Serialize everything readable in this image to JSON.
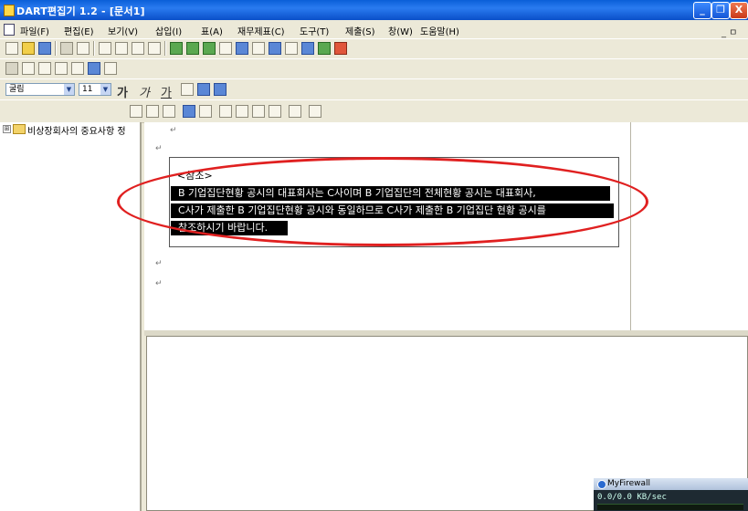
{
  "window": {
    "title": "DART편집기 1.2 - [문서1]",
    "controls": {
      "minimize": "_",
      "restore": "❐",
      "close": "X"
    }
  },
  "menubar": {
    "items": [
      "파일(F)",
      "편집(E)",
      "보기(V)",
      "삽입(I)",
      "표(A)",
      "재무제표(C)",
      "도구(T)",
      "제출(S)",
      "창(W)",
      "도움말(H)"
    ],
    "mdi_controls": "_ ㅁ"
  },
  "format_toolbar": {
    "font": "굴림",
    "size": "11",
    "bold": "가",
    "italic": "가",
    "underline": "가"
  },
  "tree": {
    "expander": "⊞",
    "root_label": "비상장회사의 중요사항 정"
  },
  "editor": {
    "para_mark": "↵",
    "ref_title": "<참조>",
    "highlight_lines": [
      "B 기업집단현황 공시의 대표회사는 C사이며 B 기업집단의 전체현황 공시는 대표회사,",
      "C사가 제출한 B 기업집단현황 공시와 동일하므로 C사가 제출한 B 기업집단 현황 공시를",
      "참조하시기 바랍니다."
    ]
  },
  "firewall": {
    "title": "MyFirewall",
    "speed": "0.0/0.0 KB/sec"
  },
  "colors": {
    "annotation_ring": "#e02020",
    "titlebar": "#0a5fd8"
  }
}
